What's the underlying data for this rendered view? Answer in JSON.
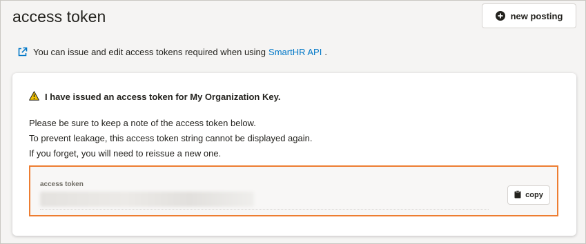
{
  "header": {
    "title": "access token",
    "new_posting_label": "new posting"
  },
  "info": {
    "text_before": "You can issue and edit access tokens required when using",
    "link_text": "SmartHR API",
    "text_after": "."
  },
  "alert": {
    "heading": "I have issued an access token for My Organization Key.",
    "lines": [
      "Please be sure to keep a note of the access token below.",
      "To prevent leakage, this access token string cannot be displayed again.",
      "If you forget, you will need to reissue a new one."
    ]
  },
  "token": {
    "label": "access token",
    "copy_label": "copy"
  },
  "colors": {
    "link": "#0077c7",
    "highlight_border": "#ed7d31",
    "warning": "#f2c200"
  },
  "icons": [
    "external-link-icon",
    "plus-circle-icon",
    "warning-icon",
    "clipboard-icon"
  ]
}
